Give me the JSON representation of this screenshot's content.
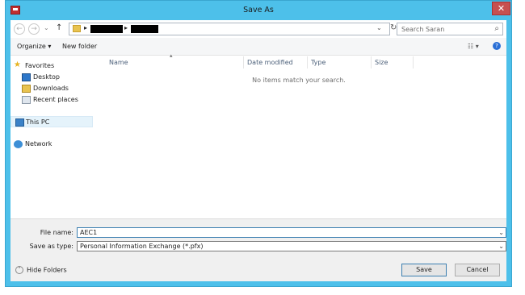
{
  "window": {
    "title": "Save As",
    "close_glyph": "✕"
  },
  "navigation": {
    "back_glyph": "←",
    "forward_glyph": "→",
    "recent_glyph": "⌄",
    "up_glyph": "↑",
    "crumb_sep": "▸",
    "address_dropdown_glyph": "⌄",
    "refresh_glyph": "↻",
    "search_placeholder": "Search Saran",
    "search_glyph": "⌕"
  },
  "toolbar": {
    "organize_label": "Organize ▾",
    "new_folder_label": "New folder",
    "view_glyph": "☷ ▾",
    "help_glyph": "?"
  },
  "sidebar": {
    "favorites": "Favorites",
    "desktop": "Desktop",
    "downloads": "Downloads",
    "recent_places": "Recent places",
    "this_pc": "This PC",
    "network": "Network"
  },
  "file_list": {
    "columns": [
      "Name",
      "Date modified",
      "Type",
      "Size"
    ],
    "sort_glyph": "▴",
    "empty_message": "No items match your search."
  },
  "save_form": {
    "file_name_label": "File name:",
    "file_name_value": "AEC1",
    "save_type_label": "Save as type:",
    "save_type_value": "Personal Information Exchange (*.pfx)",
    "dropdown_glyph": "⌄"
  },
  "footer": {
    "hide_folders_label": "Hide Folders",
    "hide_folders_glyph": "˄",
    "save_label": "Save",
    "cancel_label": "Cancel"
  },
  "colors": {
    "title_bar": "#4dc0ea",
    "close_button": "#c75050",
    "selected_nav": "#e5f3fb"
  }
}
